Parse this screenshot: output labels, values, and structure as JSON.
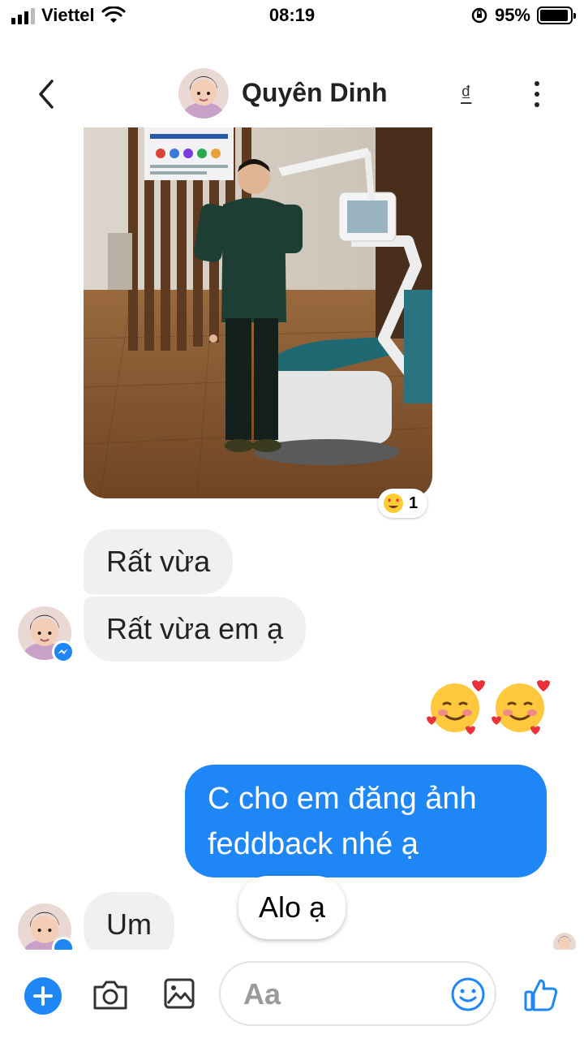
{
  "status_bar": {
    "carrier": "Viettel",
    "time": "08:19",
    "battery_percent": "95%",
    "battery_level": 0.95
  },
  "header": {
    "contact_name": "Quyên Dinh",
    "currency_symbol": "₫",
    "back_icon": "chevron-left-icon",
    "more_icon": "more-vertical-icon"
  },
  "photo_message": {
    "reaction_emoji": "😍",
    "reaction_count": "1"
  },
  "messages": {
    "incoming_1": "Rất vừa",
    "incoming_2": "Rất vừa em ạ",
    "emoji_message": "🥰🥰",
    "outgoing_line_1": "C cho em đăng ảnh",
    "outgoing_line_2": "feddback nhé ạ",
    "overlay_bubble": "Alo ạ",
    "incoming_3": "Um"
  },
  "composer": {
    "placeholder": "Aa",
    "icons": [
      "plus-icon",
      "camera-icon",
      "image-icon",
      "smile-icon",
      "thumbs-up-icon"
    ]
  },
  "colors": {
    "accent": "#1e86f5",
    "incoming_bubble": "#f0f0f0"
  }
}
